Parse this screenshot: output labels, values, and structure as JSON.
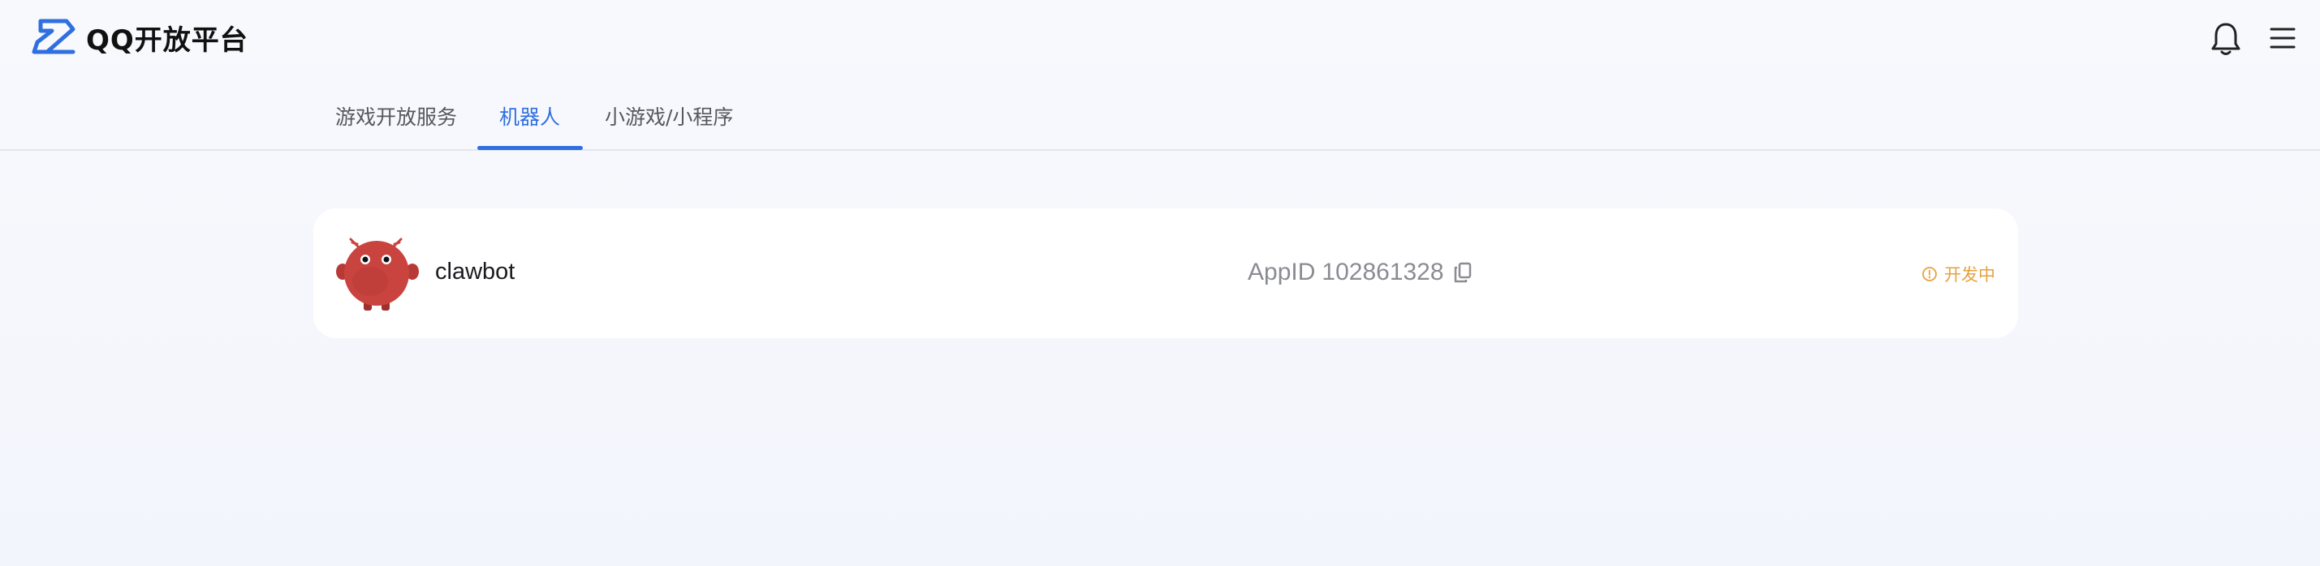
{
  "header": {
    "logo_text": "QQ开放平台",
    "logo_icon": "qq-platform-logo-icon",
    "bell_icon": "bell-icon",
    "menu_icon": "hamburger-menu-icon"
  },
  "tabs": [
    {
      "label": "游戏开放服务",
      "active": false
    },
    {
      "label": "机器人",
      "active": true
    },
    {
      "label": "小游戏/小程序",
      "active": false
    }
  ],
  "bot": {
    "name": "clawbot",
    "appid_label": "AppID",
    "appid_value": "102861328",
    "status": "开发中",
    "copy_icon": "copy-icon",
    "status_icon": "info-circle-icon"
  },
  "colors": {
    "accent": "#2f6fe0",
    "status": "#e6a23c",
    "avatar": "#c9433f"
  }
}
